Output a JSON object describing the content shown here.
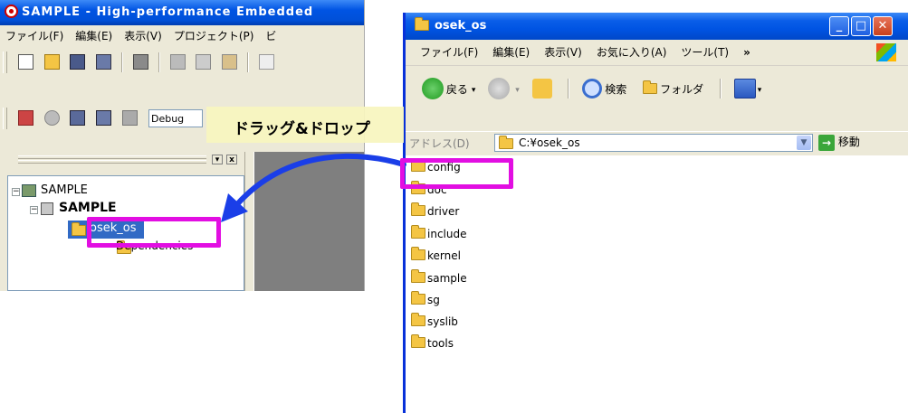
{
  "ide": {
    "title": "SAMPLE - High-performance Embedded",
    "menu": [
      "ファイル(F)",
      "編集(E)",
      "表示(V)",
      "プロジェクト(P)",
      "ビ"
    ],
    "build_config": "Debug",
    "panel_close": "x",
    "tree": {
      "workspace": "SAMPLE",
      "project": "SAMPLE",
      "folder": "osek_os",
      "dependencies": "Dependencies"
    }
  },
  "explorer": {
    "title": "osek_os",
    "menu": [
      "ファイル(F)",
      "編集(E)",
      "表示(V)",
      "お気に入り(A)",
      "ツール(T)"
    ],
    "menu_more": "»",
    "toolbar": {
      "back": "戻る",
      "search": "検索",
      "folders": "フォルダ"
    },
    "address_label": "アドレス(D)",
    "address_value": "C:¥osek_os",
    "go_label": "移動",
    "files": [
      "config",
      "doc",
      "driver",
      "include",
      "kernel",
      "sample",
      "sg",
      "syslib",
      "tools"
    ]
  },
  "annotation": {
    "text": "ドラッグ&ドロップ"
  },
  "colors": {
    "highlight": "#e20ee2",
    "arrow": "#1a3ee8",
    "titlebar": "#0054e3"
  }
}
